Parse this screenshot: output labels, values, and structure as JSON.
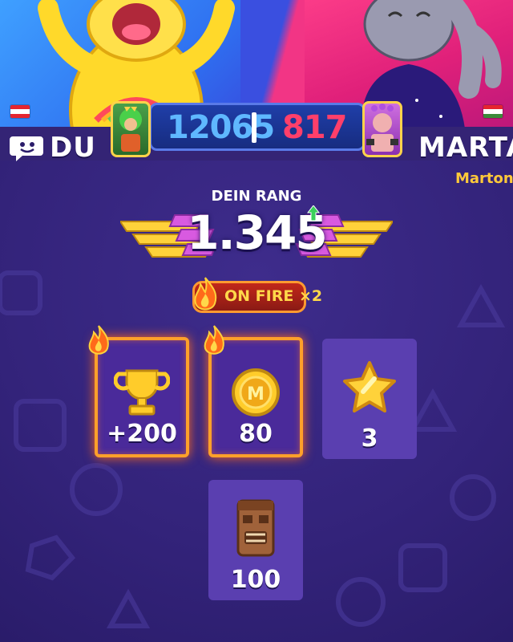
{
  "players": {
    "left": {
      "name": "DU",
      "flag": [
        "#e52530",
        "#ffffff",
        "#e52530"
      ],
      "color": "#5fb8ff"
    },
    "right": {
      "name": "MARTA",
      "subname": "Marton",
      "flag": [
        "#e52530",
        "#ffffff",
        "#3c8a3a"
      ],
      "color": "#ff3f6a"
    }
  },
  "score": {
    "left": "12065",
    "right": "817"
  },
  "rank": {
    "label": "DEIN RANG",
    "value": "1.345",
    "trend": "up"
  },
  "fire_badge": {
    "label": "ON FIRE ×2"
  },
  "rewards": [
    {
      "icon": "trophy-icon",
      "value": "+200",
      "on_fire": true
    },
    {
      "icon": "coin-icon",
      "value": "80",
      "on_fire": true
    },
    {
      "icon": "star-icon",
      "value": "3",
      "on_fire": false
    },
    {
      "icon": "tiki-mask-icon",
      "value": "100",
      "on_fire": false
    }
  ],
  "coin_letter": "M"
}
